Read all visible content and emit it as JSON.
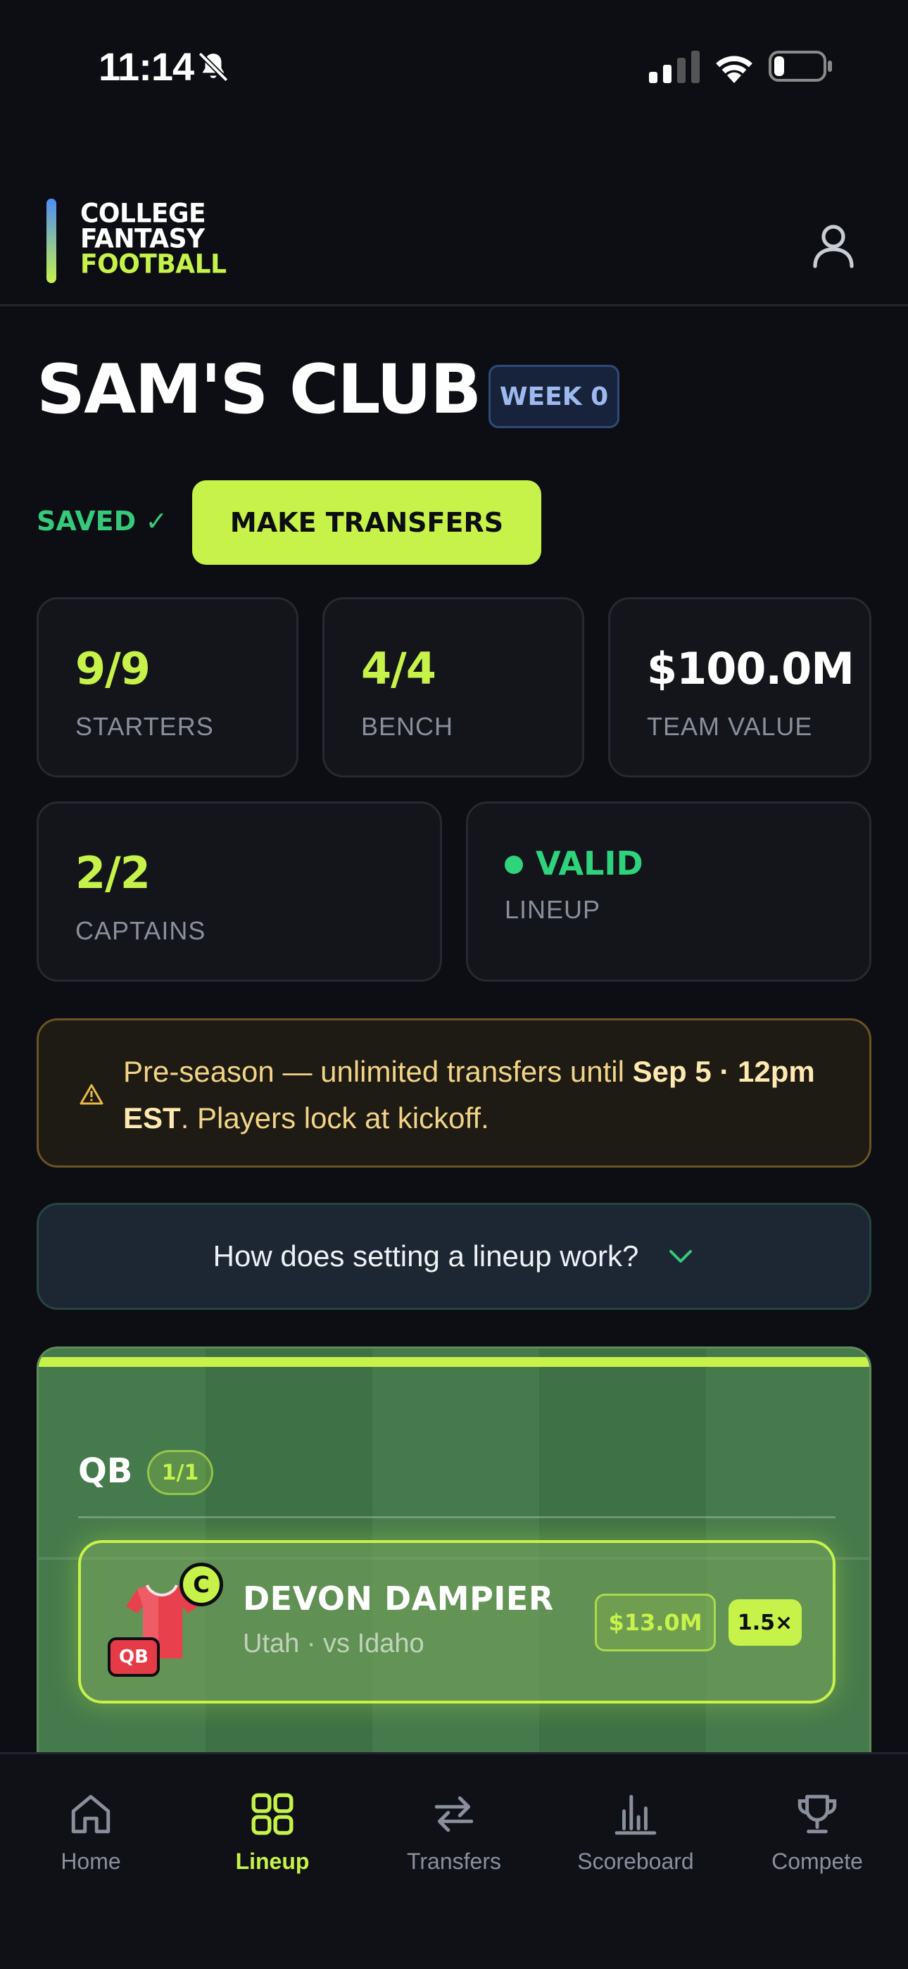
{
  "status_bar": {
    "time": "11:14"
  },
  "header": {
    "logo_line1": "COLLEGE",
    "logo_line2": "FANTASY",
    "logo_line3": "FOOTBALL"
  },
  "team": {
    "name": "SAM'S CLUB",
    "week": "WEEK 0"
  },
  "actions": {
    "saved": "SAVED ✓",
    "make_transfers": "MAKE TRANSFERS"
  },
  "stats": [
    {
      "value": "9/9",
      "label": "STARTERS"
    },
    {
      "value": "4/4",
      "label": "BENCH"
    },
    {
      "value": "$100.0M",
      "label": "TEAM VALUE"
    },
    {
      "value": "2/2",
      "label": "CAPTAINS"
    },
    {
      "value": "VALID",
      "label": "LINEUP"
    }
  ],
  "notice": {
    "text_a": "Pre-season — unlimited transfers until ",
    "bold_a": "Sep 5 · 12pm EST",
    "text_b": ". Players lock at kickoff."
  },
  "howto": {
    "label": "How does setting a lineup work?"
  },
  "lineup": {
    "position": "QB",
    "count": "1/1",
    "player": {
      "captain": "C",
      "pos_tag": "QB",
      "name": "DEVON DAMPIER",
      "sub": "Utah · vs Idaho",
      "price": "$13.0M",
      "multiplier": "1.5×"
    }
  },
  "tabs": [
    {
      "label": "Home"
    },
    {
      "label": "Lineup"
    },
    {
      "label": "Transfers"
    },
    {
      "label": "Scoreboard"
    },
    {
      "label": "Compete"
    }
  ],
  "colors": {
    "accent": "#c6f24a",
    "valid": "#2fd37b",
    "background": "#0c0e13"
  }
}
